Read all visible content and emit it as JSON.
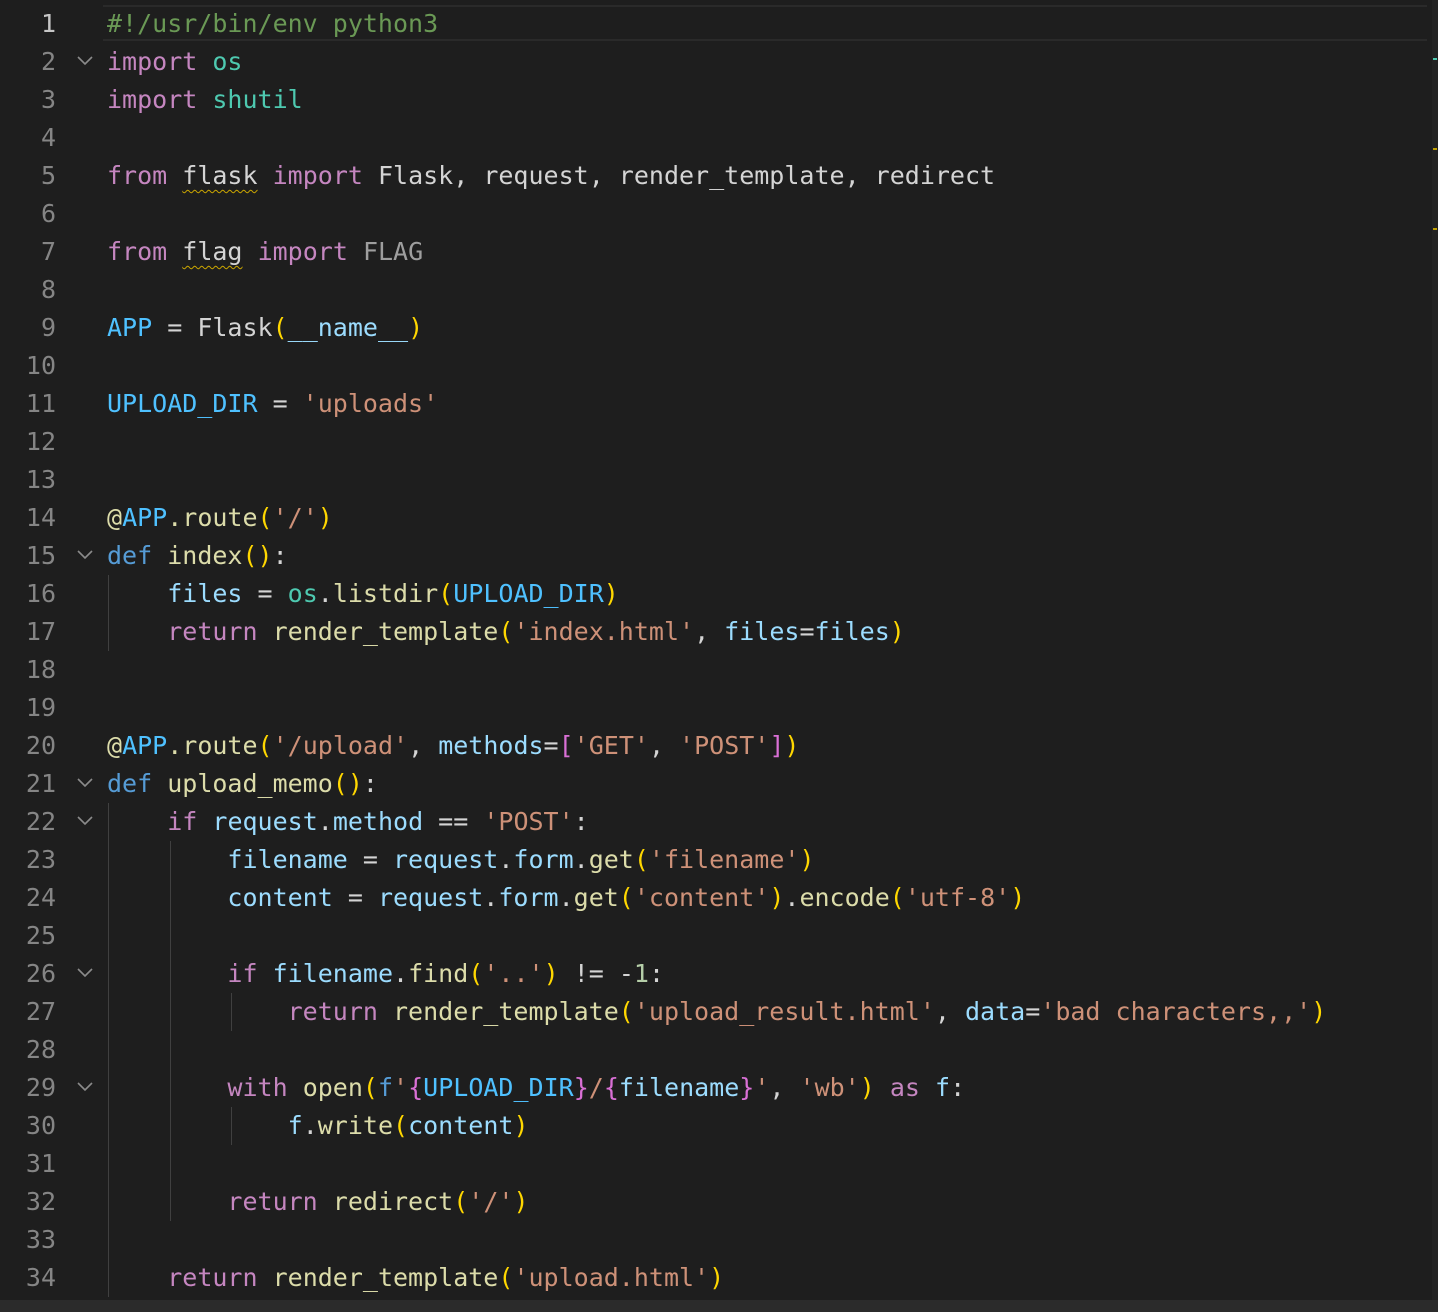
{
  "editor": {
    "language": "python",
    "active_line": 1,
    "line_numbers": [
      "1",
      "2",
      "3",
      "4",
      "5",
      "6",
      "7",
      "8",
      "9",
      "10",
      "11",
      "12",
      "13",
      "14",
      "15",
      "16",
      "17",
      "18",
      "19",
      "20",
      "21",
      "22",
      "23",
      "24",
      "25",
      "26",
      "27",
      "28",
      "29",
      "30",
      "31",
      "32",
      "33",
      "34"
    ],
    "folding_lines": [
      2,
      15,
      21,
      22,
      26,
      29
    ],
    "squiggle_words": [
      "flask",
      "flag"
    ],
    "lines": [
      [
        {
          "t": "#!/usr/bin/env python3",
          "c": "cm"
        }
      ],
      [
        {
          "t": "import",
          "c": "kw"
        },
        {
          "t": " "
        },
        {
          "t": "os",
          "c": "mod"
        }
      ],
      [
        {
          "t": "import",
          "c": "kw"
        },
        {
          "t": " "
        },
        {
          "t": "shutil",
          "c": "mod"
        }
      ],
      [],
      [
        {
          "t": "from",
          "c": "kw"
        },
        {
          "t": " "
        },
        {
          "t": "flask",
          "c": "plain",
          "sq": true
        },
        {
          "t": " "
        },
        {
          "t": "import",
          "c": "kw"
        },
        {
          "t": " Flask, request, render_template, redirect"
        }
      ],
      [],
      [
        {
          "t": "from",
          "c": "kw"
        },
        {
          "t": " "
        },
        {
          "t": "flag",
          "c": "plain",
          "sq": true
        },
        {
          "t": " "
        },
        {
          "t": "import",
          "c": "kw"
        },
        {
          "t": " "
        },
        {
          "t": "FLAG",
          "c": "dim"
        }
      ],
      [],
      [
        {
          "t": "APP",
          "c": "cst"
        },
        {
          "t": " = "
        },
        {
          "t": "Flask"
        },
        {
          "t": "(",
          "c": "b1"
        },
        {
          "t": "__name__",
          "c": "var"
        },
        {
          "t": ")",
          "c": "b1"
        }
      ],
      [],
      [
        {
          "t": "UPLOAD_DIR",
          "c": "cst"
        },
        {
          "t": " = "
        },
        {
          "t": "'uploads'",
          "c": "str"
        }
      ],
      [],
      [],
      [
        {
          "t": "@",
          "c": "fn"
        },
        {
          "t": "APP",
          "c": "cst"
        },
        {
          "t": ".",
          "c": "fn"
        },
        {
          "t": "route",
          "c": "fn"
        },
        {
          "t": "(",
          "c": "b1"
        },
        {
          "t": "'/'",
          "c": "str"
        },
        {
          "t": ")",
          "c": "b1"
        }
      ],
      [
        {
          "t": "def",
          "c": "blu"
        },
        {
          "t": " "
        },
        {
          "t": "index",
          "c": "fn"
        },
        {
          "t": "()",
          "c": "b1"
        },
        {
          "t": ":"
        }
      ],
      [
        {
          "t": "    "
        },
        {
          "t": "files",
          "c": "var"
        },
        {
          "t": " = "
        },
        {
          "t": "os",
          "c": "mod"
        },
        {
          "t": "."
        },
        {
          "t": "listdir",
          "c": "fn"
        },
        {
          "t": "(",
          "c": "b1"
        },
        {
          "t": "UPLOAD_DIR",
          "c": "cst"
        },
        {
          "t": ")",
          "c": "b1"
        }
      ],
      [
        {
          "t": "    "
        },
        {
          "t": "return",
          "c": "kw"
        },
        {
          "t": " "
        },
        {
          "t": "render_template",
          "c": "fn"
        },
        {
          "t": "(",
          "c": "b1"
        },
        {
          "t": "'index.html'",
          "c": "str"
        },
        {
          "t": ", "
        },
        {
          "t": "files",
          "c": "var"
        },
        {
          "t": "="
        },
        {
          "t": "files",
          "c": "var"
        },
        {
          "t": ")",
          "c": "b1"
        }
      ],
      [],
      [],
      [
        {
          "t": "@",
          "c": "fn"
        },
        {
          "t": "APP",
          "c": "cst"
        },
        {
          "t": ".",
          "c": "fn"
        },
        {
          "t": "route",
          "c": "fn"
        },
        {
          "t": "(",
          "c": "b1"
        },
        {
          "t": "'/upload'",
          "c": "str"
        },
        {
          "t": ", "
        },
        {
          "t": "methods",
          "c": "var"
        },
        {
          "t": "="
        },
        {
          "t": "[",
          "c": "b2"
        },
        {
          "t": "'GET'",
          "c": "str"
        },
        {
          "t": ", "
        },
        {
          "t": "'POST'",
          "c": "str"
        },
        {
          "t": "]",
          "c": "b2"
        },
        {
          "t": ")",
          "c": "b1"
        }
      ],
      [
        {
          "t": "def",
          "c": "blu"
        },
        {
          "t": " "
        },
        {
          "t": "upload_memo",
          "c": "fn"
        },
        {
          "t": "()",
          "c": "b1"
        },
        {
          "t": ":"
        }
      ],
      [
        {
          "t": "    "
        },
        {
          "t": "if",
          "c": "kw"
        },
        {
          "t": " "
        },
        {
          "t": "request",
          "c": "var"
        },
        {
          "t": "."
        },
        {
          "t": "method",
          "c": "var"
        },
        {
          "t": " == "
        },
        {
          "t": "'POST'",
          "c": "str"
        },
        {
          "t": ":"
        }
      ],
      [
        {
          "t": "        "
        },
        {
          "t": "filename",
          "c": "var"
        },
        {
          "t": " = "
        },
        {
          "t": "request",
          "c": "var"
        },
        {
          "t": "."
        },
        {
          "t": "form",
          "c": "var"
        },
        {
          "t": "."
        },
        {
          "t": "get",
          "c": "fn"
        },
        {
          "t": "(",
          "c": "b1"
        },
        {
          "t": "'filename'",
          "c": "str"
        },
        {
          "t": ")",
          "c": "b1"
        }
      ],
      [
        {
          "t": "        "
        },
        {
          "t": "content",
          "c": "var"
        },
        {
          "t": " = "
        },
        {
          "t": "request",
          "c": "var"
        },
        {
          "t": "."
        },
        {
          "t": "form",
          "c": "var"
        },
        {
          "t": "."
        },
        {
          "t": "get",
          "c": "fn"
        },
        {
          "t": "(",
          "c": "b1"
        },
        {
          "t": "'content'",
          "c": "str"
        },
        {
          "t": ")",
          "c": "b1"
        },
        {
          "t": "."
        },
        {
          "t": "encode",
          "c": "fn"
        },
        {
          "t": "(",
          "c": "b1"
        },
        {
          "t": "'utf-8'",
          "c": "str"
        },
        {
          "t": ")",
          "c": "b1"
        }
      ],
      [],
      [
        {
          "t": "        "
        },
        {
          "t": "if",
          "c": "kw"
        },
        {
          "t": " "
        },
        {
          "t": "filename",
          "c": "var"
        },
        {
          "t": "."
        },
        {
          "t": "find",
          "c": "fn"
        },
        {
          "t": "(",
          "c": "b1"
        },
        {
          "t": "'..'",
          "c": "str"
        },
        {
          "t": ")",
          "c": "b1"
        },
        {
          "t": " != -"
        },
        {
          "t": "1",
          "c": "num"
        },
        {
          "t": ":"
        }
      ],
      [
        {
          "t": "            "
        },
        {
          "t": "return",
          "c": "kw"
        },
        {
          "t": " "
        },
        {
          "t": "render_template",
          "c": "fn"
        },
        {
          "t": "(",
          "c": "b1"
        },
        {
          "t": "'upload_result.html'",
          "c": "str"
        },
        {
          "t": ", "
        },
        {
          "t": "data",
          "c": "var"
        },
        {
          "t": "="
        },
        {
          "t": "'bad characters,,'",
          "c": "str"
        },
        {
          "t": ")",
          "c": "b1"
        }
      ],
      [],
      [
        {
          "t": "        "
        },
        {
          "t": "with",
          "c": "kw"
        },
        {
          "t": " "
        },
        {
          "t": "open",
          "c": "fn"
        },
        {
          "t": "(",
          "c": "b1"
        },
        {
          "t": "f",
          "c": "blu"
        },
        {
          "t": "'",
          "c": "str"
        },
        {
          "t": "{",
          "c": "b2"
        },
        {
          "t": "UPLOAD_DIR",
          "c": "cst"
        },
        {
          "t": "}",
          "c": "b2"
        },
        {
          "t": "/",
          "c": "str"
        },
        {
          "t": "{",
          "c": "b2"
        },
        {
          "t": "filename",
          "c": "var"
        },
        {
          "t": "}",
          "c": "b2"
        },
        {
          "t": "'",
          "c": "str"
        },
        {
          "t": ", "
        },
        {
          "t": "'wb'",
          "c": "str"
        },
        {
          "t": ")",
          "c": "b1"
        },
        {
          "t": " "
        },
        {
          "t": "as",
          "c": "kw"
        },
        {
          "t": " "
        },
        {
          "t": "f",
          "c": "var"
        },
        {
          "t": ":"
        }
      ],
      [
        {
          "t": "            "
        },
        {
          "t": "f",
          "c": "var"
        },
        {
          "t": "."
        },
        {
          "t": "write",
          "c": "fn"
        },
        {
          "t": "(",
          "c": "b1"
        },
        {
          "t": "content",
          "c": "var"
        },
        {
          "t": ")",
          "c": "b1"
        }
      ],
      [],
      [
        {
          "t": "        "
        },
        {
          "t": "return",
          "c": "kw"
        },
        {
          "t": " "
        },
        {
          "t": "redirect",
          "c": "fn"
        },
        {
          "t": "(",
          "c": "b1"
        },
        {
          "t": "'/'",
          "c": "str"
        },
        {
          "t": ")",
          "c": "b1"
        }
      ],
      [],
      [
        {
          "t": "    "
        },
        {
          "t": "return",
          "c": "kw"
        },
        {
          "t": " "
        },
        {
          "t": "render_template",
          "c": "fn"
        },
        {
          "t": "(",
          "c": "b1"
        },
        {
          "t": "'upload.html'",
          "c": "str"
        },
        {
          "t": ")",
          "c": "b1"
        }
      ]
    ]
  },
  "colors": {
    "background": "#1e1e1e",
    "comment": "#6a9955",
    "keyword_control": "#c586c0",
    "keyword_storage": "#569cd6",
    "module": "#4ec9b0",
    "variable": "#9cdcfe",
    "constant": "#4fc1ff",
    "function": "#dcdcaa",
    "string": "#ce9178",
    "number": "#b5cea8",
    "bracket_level1": "#ffd700",
    "bracket_level2": "#da70d6",
    "warning_squiggle": "#cca700"
  }
}
